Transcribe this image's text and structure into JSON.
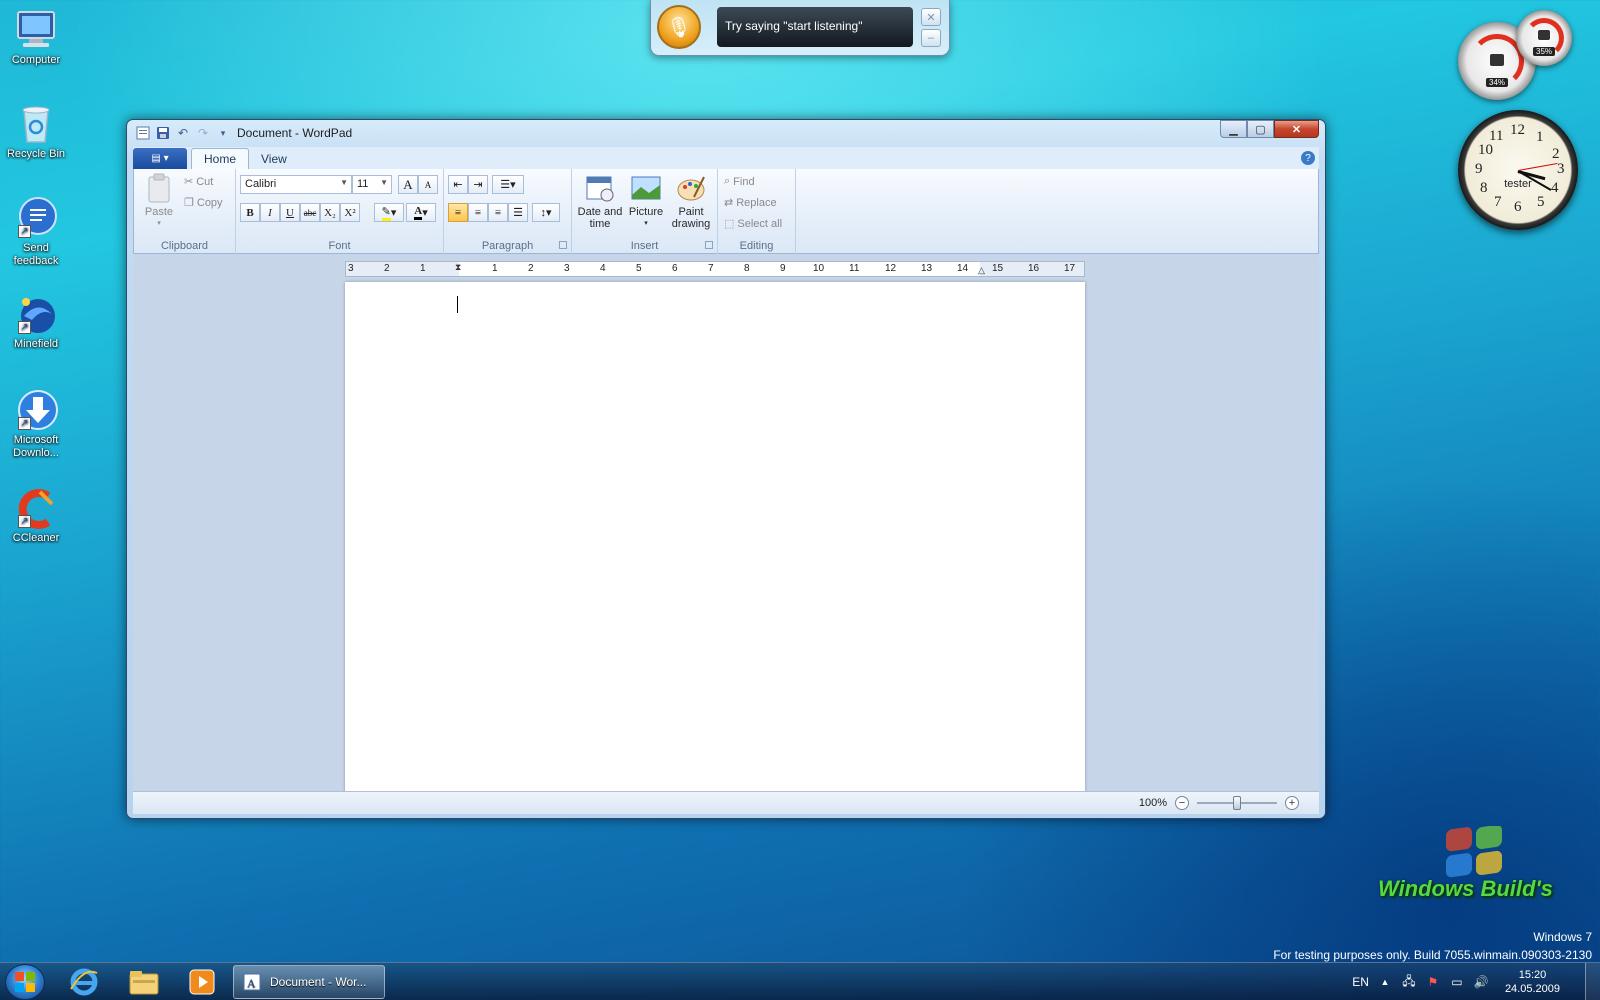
{
  "desktop": {
    "icons": [
      {
        "label": "Computer",
        "icon": "computer-icon"
      },
      {
        "label": "Recycle Bin",
        "icon": "recycle-bin-icon"
      },
      {
        "label": "Send feedback",
        "icon": "feedback-icon"
      },
      {
        "label": "Minefield",
        "icon": "minefield-icon"
      },
      {
        "label": "Microsoft Downlo...",
        "icon": "download-icon"
      },
      {
        "label": "CCleaner",
        "icon": "ccleaner-icon"
      }
    ]
  },
  "speech": {
    "prompt": "Try saying \"start listening\""
  },
  "gadgets": {
    "cpu_percent": "34%",
    "memory_percent": "35%",
    "clock_name": "tester",
    "clock_numbers": [
      "12",
      "1",
      "2",
      "3",
      "4",
      "5",
      "6",
      "7",
      "8",
      "9",
      "10",
      "11"
    ]
  },
  "window": {
    "title": "Document - WordPad",
    "tabs": [
      "Home",
      "View"
    ],
    "ribbon": {
      "clipboard": {
        "label": "Clipboard",
        "paste": "Paste",
        "cut": "Cut",
        "copy": "Copy"
      },
      "font": {
        "label": "Font",
        "family": "Calibri",
        "size": "11",
        "bold": "B",
        "italic": "I",
        "underline": "U",
        "strike": "abc",
        "subscript": "X₂",
        "superscript": "X²",
        "color": "A",
        "grow": "A",
        "shrink": "A"
      },
      "paragraph": {
        "label": "Paragraph"
      },
      "insert": {
        "label": "Insert",
        "datetime": "Date and time",
        "picture": "Picture",
        "paint": "Paint drawing"
      },
      "editing": {
        "label": "Editing",
        "find": "Find",
        "replace": "Replace",
        "select_all": "Select all"
      }
    },
    "ruler_ticks": [
      "3",
      "2",
      "1",
      "1",
      "2",
      "3",
      "4",
      "5",
      "6",
      "7",
      "8",
      "9",
      "10",
      "11",
      "12",
      "13",
      "14",
      "15",
      "16",
      "17"
    ],
    "status": {
      "zoom": "100%",
      "zoom_level": 0.5
    }
  },
  "watermark": {
    "brand": "Windows Build's",
    "os": "Windows 7",
    "build": "For testing purposes only. Build 7055.winmain.090303-2130"
  },
  "taskbar": {
    "task_label": "Document - Wor...",
    "language": "EN",
    "time": "15:20",
    "date": "24.05.2009"
  },
  "colors": {
    "accent": "#1a4b9e",
    "taskbar": "#123f7a",
    "close": "#c8462e"
  }
}
